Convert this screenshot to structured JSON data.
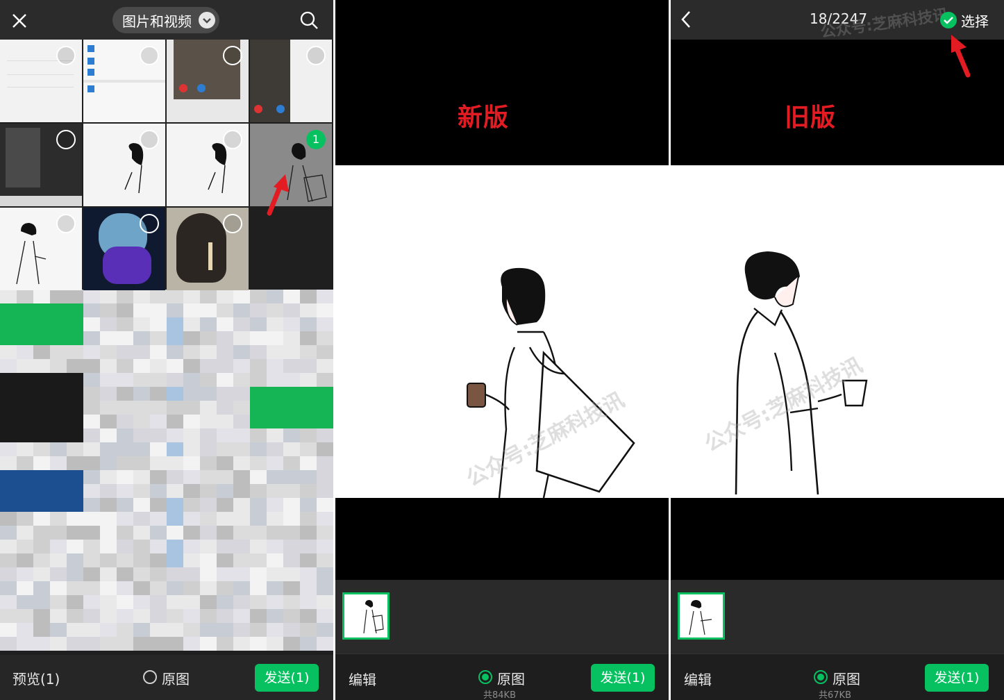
{
  "picker": {
    "album_title": "图片和视频",
    "preview_label": "预览(1)",
    "original_label": "原图",
    "send_label": "发送(1)",
    "selected_index": "1"
  },
  "new_version": {
    "tag": "新版",
    "edit_label": "编辑",
    "original_label": "原图",
    "size_label": "共84KB",
    "send_label": "发送(1)",
    "watermark": "公众号:芝麻科技讯"
  },
  "old_version": {
    "tag": "旧版",
    "counter": "18/2247",
    "select_label": "选择",
    "edit_label": "编辑",
    "original_label": "原图",
    "size_label": "共67KB",
    "send_label": "发送(1)",
    "watermark": "公众号:芝麻科技讯"
  },
  "colors": {
    "accent_green": "#07c160",
    "tag_red": "#e31b23",
    "arrow_red": "#e31b23"
  },
  "icons": [
    "close-icon",
    "chevron-down-icon",
    "search-icon",
    "back-icon",
    "check-icon",
    "arrow-pointer-icon"
  ]
}
